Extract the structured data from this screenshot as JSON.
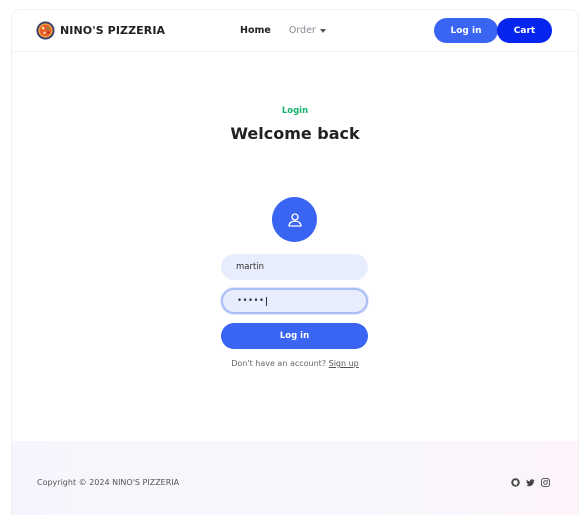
{
  "brand": {
    "name": "NINO'S PIZZERIA"
  },
  "nav": {
    "home": "Home",
    "order": "Order",
    "login_button": "Log in",
    "cart_button": "Cart"
  },
  "login": {
    "eyebrow": "Login",
    "heading": "Welcome back",
    "username_value": "martin",
    "password_value": "•••••",
    "submit_label": "Log in",
    "signup_prompt": "Don't have an account?",
    "signup_link": "Sign up"
  },
  "footer": {
    "copyright": "Copyright © 2024 NINO'S PIZZERIA",
    "social_icons": [
      "github-icon",
      "twitter-icon",
      "instagram-icon"
    ]
  },
  "colors": {
    "primary": "#3a64f2",
    "cart": "#0626ef",
    "eyebrow": "#16b26b",
    "field_bg": "#e8edfd"
  }
}
